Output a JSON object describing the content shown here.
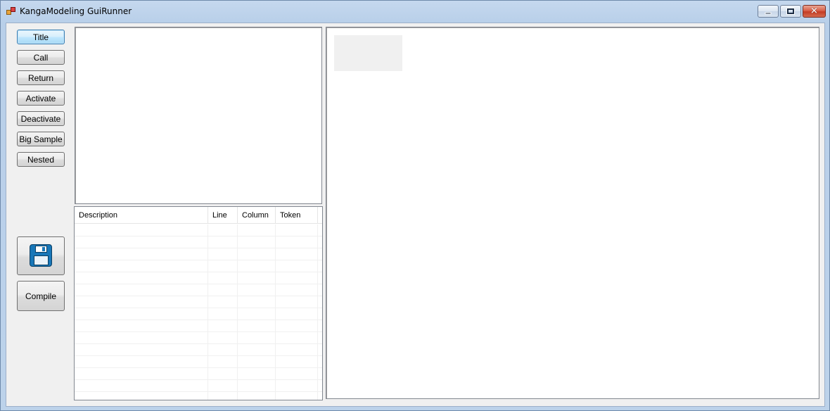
{
  "window": {
    "title": "KangaModeling GuiRunner",
    "icon": "app-icon",
    "controls": {
      "minimize": "minimize-icon",
      "maximize": "maximize-icon",
      "close": "close-icon",
      "close_glyph": "✕"
    }
  },
  "sidebar": {
    "buttons": [
      {
        "label": "Title"
      },
      {
        "label": "Call"
      },
      {
        "label": "Return"
      },
      {
        "label": "Activate"
      },
      {
        "label": "Deactivate"
      },
      {
        "label": "Big Sample"
      },
      {
        "label": "Nested"
      }
    ],
    "save_icon": "floppy-disk-icon",
    "compile_label": "Compile"
  },
  "errors_grid": {
    "columns": [
      "Description",
      "Line",
      "Column",
      "Token"
    ],
    "rows": []
  },
  "colors": {
    "accent_focus": "#3c7fb1",
    "close_button": "#c43c24",
    "client_bg": "#f0f0f0"
  }
}
